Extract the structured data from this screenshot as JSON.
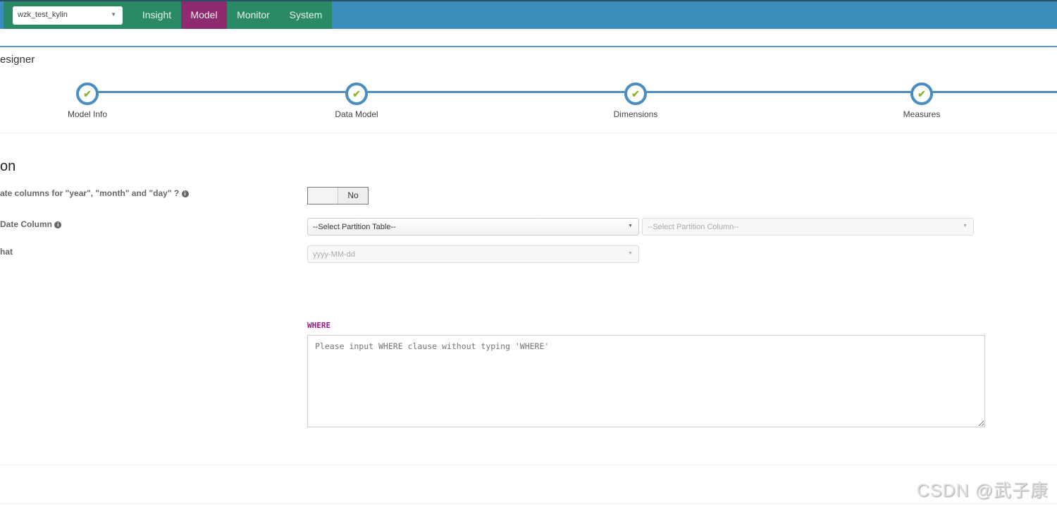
{
  "topbar": {
    "project": "wzk_test_kylin",
    "nav": [
      "Insight",
      "Model",
      "Monitor",
      "System"
    ],
    "active": "Model"
  },
  "page_title": "esigner",
  "steps": [
    {
      "label": "Model Info"
    },
    {
      "label": "Data Model"
    },
    {
      "label": "Dimensions"
    },
    {
      "label": "Measures"
    }
  ],
  "section": {
    "title": "on",
    "date_columns_label": "ate columns for \"year\", \"month\" and \"day\" ?",
    "toggle_value": "No",
    "partition_label": "Date Column",
    "partition_table_placeholder": "--Select Partition Table--",
    "partition_column_placeholder": "--Select Partition Column--",
    "format_label": "hat",
    "format_value": "yyyy-MM-dd",
    "where_label": "WHERE",
    "where_placeholder": "Please input WHERE clause without typing 'WHERE'"
  },
  "watermark": "CSDN @武子康",
  "colors": {
    "topbar": "#3c8dbc",
    "nav": "#2a8a66",
    "active": "#8e2a6e",
    "step": "#4a8dc0",
    "check": "#8bb532",
    "where": "#9b1a8a"
  }
}
